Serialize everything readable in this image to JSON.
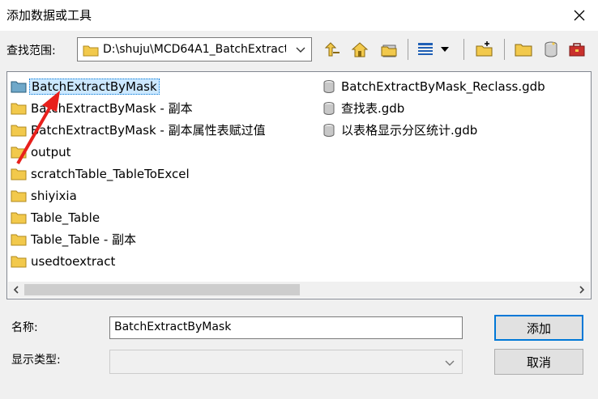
{
  "window": {
    "title": "添加数据或工具",
    "close_icon": "close-icon"
  },
  "lookin": {
    "label": "查找范围:",
    "path": "D:\\shuju\\MCD64A1_BatchExtract"
  },
  "toolbar": {
    "icons": [
      "up-one-level-icon",
      "home-icon",
      "connect-folder-icon",
      "list-view-icon",
      "view-menu-chevron-icon",
      "new-folder-icon",
      "folder-icon",
      "geodatabase-icon",
      "toolbox-icon"
    ]
  },
  "files": {
    "column1": [
      {
        "label": "BatchExtractByMask",
        "icon": "folder-icon",
        "selected": true
      },
      {
        "label": "BatchExtractByMask - 副本",
        "icon": "folder-icon"
      },
      {
        "label": "BatchExtractByMask - 副本属性表赋过值",
        "icon": "folder-icon"
      },
      {
        "label": "output",
        "icon": "folder-icon"
      },
      {
        "label": "scratchTable_TableToExcel",
        "icon": "folder-icon"
      },
      {
        "label": "shiyixia",
        "icon": "folder-icon"
      },
      {
        "label": "Table_Table",
        "icon": "folder-icon"
      },
      {
        "label": "Table_Table - 副本",
        "icon": "folder-icon"
      },
      {
        "label": "usedtoextract",
        "icon": "folder-icon"
      }
    ],
    "column2": [
      {
        "label": "BatchExtractByMask_Reclass.gdb",
        "icon": "geodatabase-icon"
      },
      {
        "label": "查找表.gdb",
        "icon": "geodatabase-icon"
      },
      {
        "label": "以表格显示分区统计.gdb",
        "icon": "geodatabase-icon"
      }
    ]
  },
  "scrollbar": {
    "left_icon": "scroll-left-icon",
    "right_icon": "scroll-right-icon"
  },
  "name": {
    "label": "名称:",
    "value": "BatchExtractByMask"
  },
  "type": {
    "label": "显示类型:",
    "value": ""
  },
  "buttons": {
    "add": "添加",
    "cancel": "取消"
  },
  "colors": {
    "selection": "#cce8ff",
    "accent": "#0078d7",
    "annotation_arrow": "#e8201c"
  }
}
